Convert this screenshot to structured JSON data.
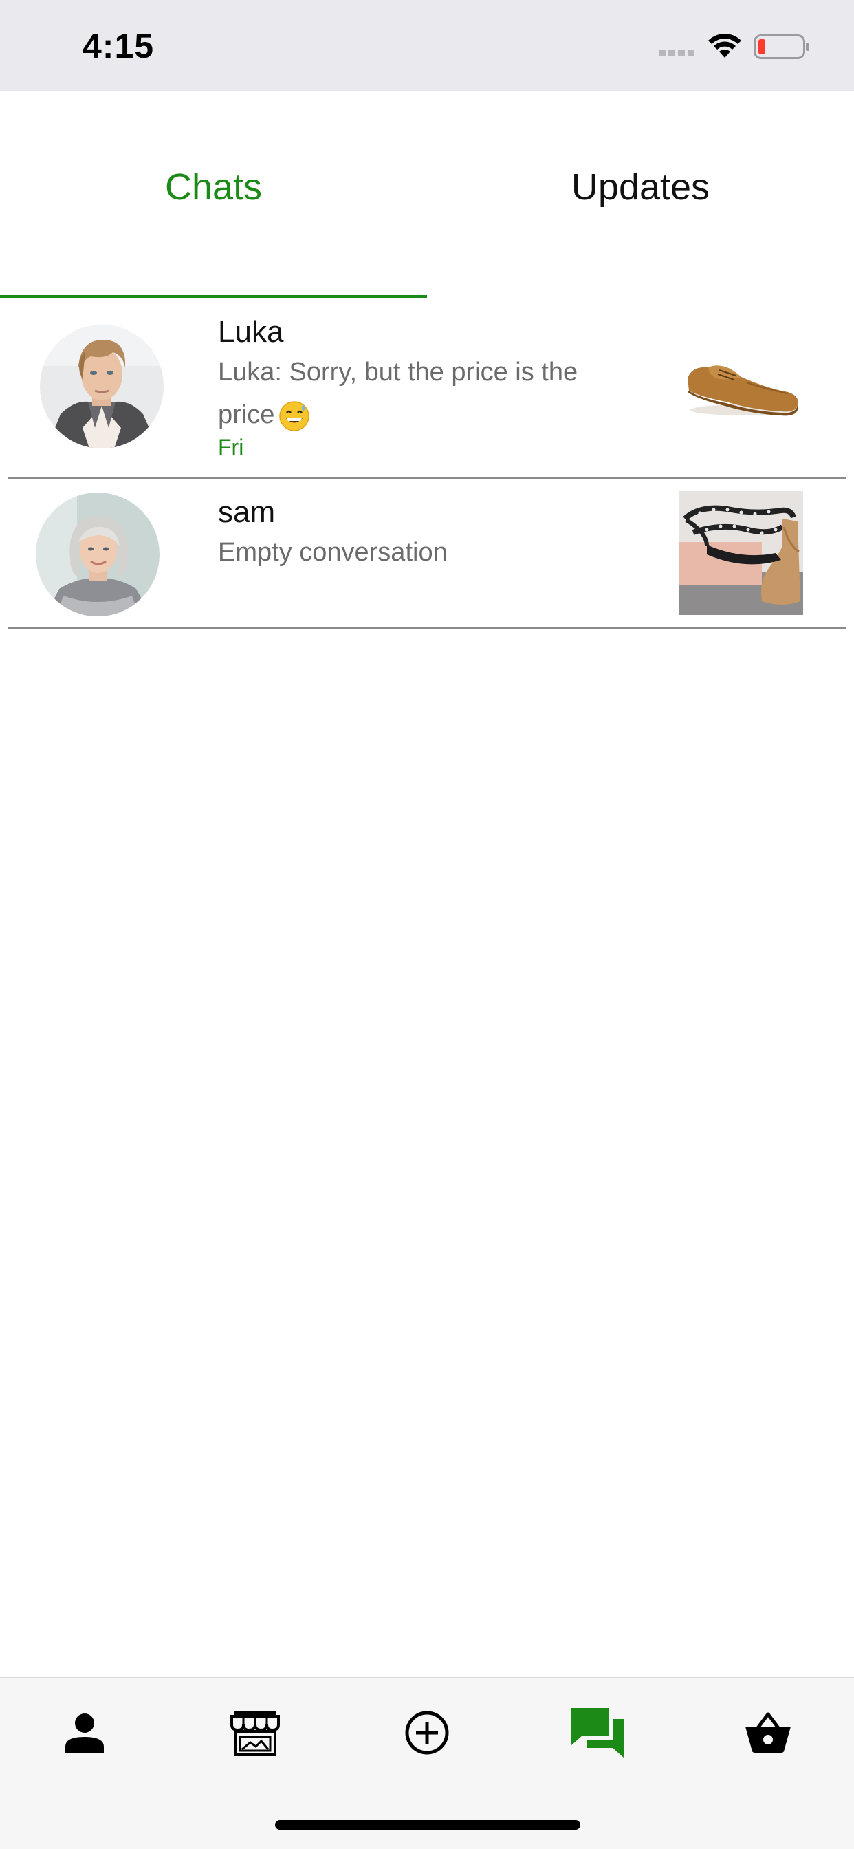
{
  "status_bar": {
    "time": "4:15"
  },
  "tabs": [
    {
      "label": "Chats",
      "active": true
    },
    {
      "label": "Updates",
      "active": false
    }
  ],
  "chats": [
    {
      "name": "Luka",
      "preview": "Luka: Sorry, but the price is the price",
      "time": "Fri",
      "avatar_icon": "male-user-avatar",
      "item_icon": "brown-shoe-image"
    },
    {
      "name": "sam",
      "preview": "Empty conversation",
      "avatar_icon": "female-user-avatar",
      "item_icon": "wedge-sandal-image"
    }
  ],
  "bottom_nav": [
    {
      "icon": "person-icon",
      "active": false
    },
    {
      "icon": "storefront-icon",
      "active": false
    },
    {
      "icon": "add-circle-icon",
      "active": false
    },
    {
      "icon": "chat-bubbles-icon",
      "active": true
    },
    {
      "icon": "basket-icon",
      "active": false
    }
  ],
  "colors": {
    "accent": "#1b8a16",
    "status_bar_bg": "#e9e9ee",
    "nav_bg": "#f6f6f6",
    "battery_low": "#ff3b30"
  }
}
